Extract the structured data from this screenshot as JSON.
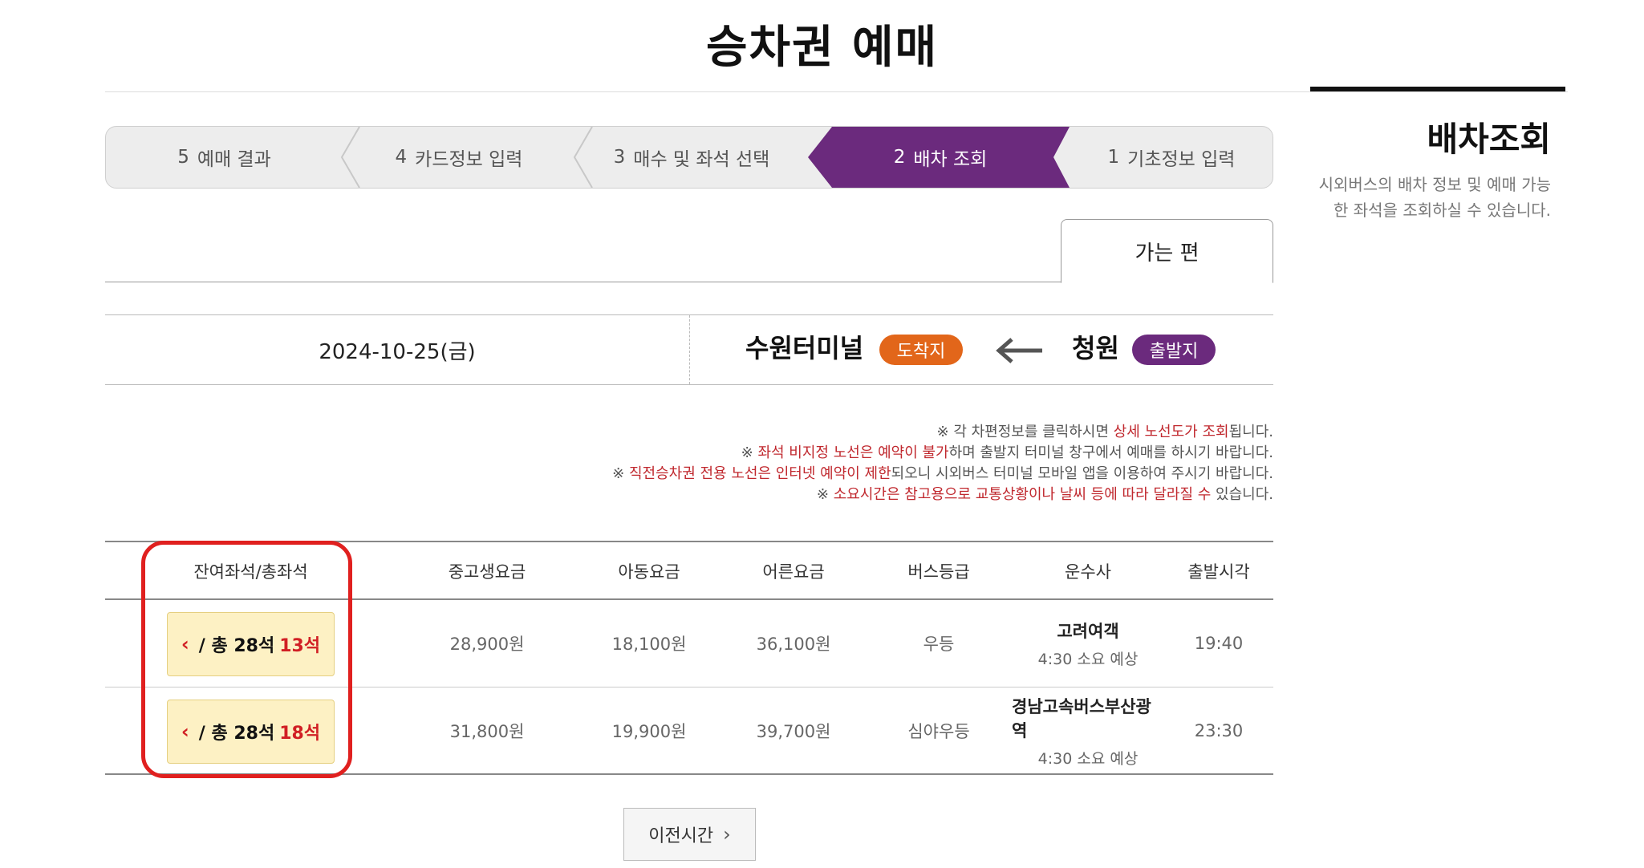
{
  "page": {
    "title": "승차권 예매"
  },
  "side": {
    "title": "배차조회",
    "description": "시외버스의 배차 정보 및 예매 가능한 좌석을 조회하실 수 있습니다."
  },
  "steps": [
    {
      "number": "1",
      "label": "기초정보 입력",
      "active": false
    },
    {
      "number": "2",
      "label": "배차 조회",
      "active": true
    },
    {
      "number": "3",
      "label": "매수 및 좌석 선택",
      "active": false
    },
    {
      "number": "4",
      "label": "카드정보 입력",
      "active": false
    },
    {
      "number": "5",
      "label": "예매 결과",
      "active": false
    }
  ],
  "tab": {
    "label": "가는 편"
  },
  "route": {
    "departure_badge": "출발지",
    "departure": "청원",
    "arrival_badge": "도착지",
    "arrival": "수원터미널",
    "date": "2024-10-25(금)"
  },
  "notices": [
    {
      "prefix": "※ 각 차편정보를 클릭하시면 ",
      "highlight": "상세 노선도가 조회",
      "suffix": "됩니다."
    },
    {
      "prefix": "※ ",
      "highlight": "좌석 비지정 노선은 예약이 불가",
      "suffix": "하며 출발지 터미널 창구에서 예매를 하시기 바랍니다."
    },
    {
      "prefix": "※ ",
      "highlight": "직전승차권 전용 노선은 인터넷 예약이 제한",
      "suffix": "되오니 시외버스 터미널 모바일 앱을 이용하여 주시기 바랍니다."
    },
    {
      "prefix": "※ ",
      "highlight": "소요시간은 참고용으로 교통상황이나 날씨 등에 따라 달라질 수",
      "suffix": " 있습니다."
    }
  ],
  "table": {
    "headers": {
      "departure_time": "출발시각",
      "company": "운수사",
      "grade": "버스등급",
      "adult": "어른요금",
      "child": "아동요금",
      "student": "중고생요금",
      "seats": "잔여좌석/총좌석"
    },
    "rows": [
      {
        "departure_time": "19:40",
        "company": "고려여객",
        "duration": "4:30 소요 예상",
        "grade": "우등",
        "adult": "36,100원",
        "child": "18,100원",
        "student": "28,900원",
        "remaining": "13석",
        "total": "/ 총 28석"
      },
      {
        "departure_time": "23:30",
        "company": "경남고속버스부산광역",
        "duration": "4:30 소요 예상",
        "grade": "심야우등",
        "adult": "39,700원",
        "child": "19,900원",
        "student": "31,800원",
        "remaining": "18석",
        "total": "/ 총 28석"
      }
    ]
  },
  "prev_button": {
    "label": "이전시간"
  },
  "colors": {
    "brand_purple": "#6b2a7d",
    "arrival_orange": "#e2661a",
    "highlight_red": "#c0282e",
    "seat_button_bg": "#fdf1c4"
  }
}
